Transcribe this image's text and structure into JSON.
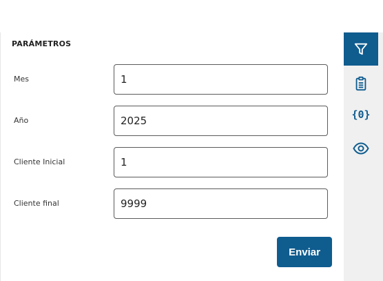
{
  "panel": {
    "title": "PARÁMETROS"
  },
  "fields": [
    {
      "label": "Mes",
      "value": "1"
    },
    {
      "label": "Año",
      "value": "2025"
    },
    {
      "label": "Cliente Inicial",
      "value": "1"
    },
    {
      "label": "Cliente final",
      "value": "9999"
    }
  ],
  "actions": {
    "submit_label": "Enviar"
  },
  "sidebar": {
    "items": [
      {
        "icon": "filter-icon",
        "active": true
      },
      {
        "icon": "clipboard-icon",
        "active": false
      },
      {
        "icon": "variables-icon",
        "glyph": "{0}",
        "active": false
      },
      {
        "icon": "eye-icon",
        "active": false
      }
    ]
  },
  "colors": {
    "accent": "#0f5c8f",
    "sidebar_bg": "#f0f0f0",
    "input_border": "#5a5a5a"
  }
}
